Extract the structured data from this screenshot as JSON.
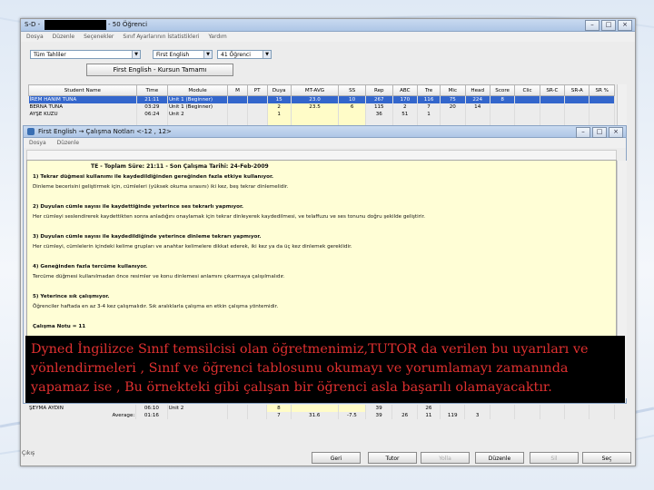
{
  "window": {
    "title_prefix": "S-D -",
    "title_suffix": "- 50 Öğrenci",
    "menu": [
      "Dosya",
      "Düzenle",
      "Seçenekler",
      "Sınıf Ayarlarının İstatistikleri",
      "Yardım"
    ]
  },
  "toolbar": {
    "filter_value": "Tüm Tahliler",
    "course_value": "First English",
    "students_value": "41 Öğrenci",
    "course_button": "First English  -  Kursun Tamamı"
  },
  "table": {
    "headers": [
      "Student Name",
      "Time",
      "Module",
      "M",
      "PT",
      "Duya",
      "MT-AVG",
      "SS",
      "Rep",
      "ABC",
      "Tre",
      "Mic",
      "Head",
      "Score",
      "Clic",
      "SR-C",
      "SR-A",
      "SR %"
    ],
    "rows": [
      [
        "İREM HANIM TUNA",
        "21:11",
        "Unit 1 (Beginner)",
        "",
        "",
        "15",
        "23.0",
        "10",
        "267",
        "170",
        "116",
        "75",
        "224",
        "8",
        "",
        "",
        "",
        ""
      ],
      [
        "BERNA TUNA",
        "03:29",
        "Unit 1 (Beginner)",
        "",
        "",
        "2",
        "23.5",
        "6",
        "115",
        "2",
        "7",
        "20",
        "14",
        "",
        "",
        "",
        "",
        ""
      ],
      [
        "AYŞE KUZU",
        "06:24",
        "Unit 2",
        "",
        "",
        "1",
        "",
        "",
        "36",
        "51",
        "1",
        "",
        "",
        "",
        "",
        "",
        "",
        ""
      ],
      [
        "",
        "",
        "",
        "",
        "",
        "",
        "",
        "",
        "",
        "",
        "",
        "",
        "",
        "",
        "",
        "",
        "",
        ""
      ]
    ],
    "bottom_rows": [
      [
        "ŞEYMA AYDIN",
        "06:10",
        "Unit 2",
        "",
        "",
        "8",
        "",
        "",
        "39",
        "",
        "26",
        "",
        "",
        "",
        "",
        "",
        "",
        ""
      ]
    ],
    "average": [
      "Average:",
      "01:16",
      "",
      "",
      "",
      "7",
      "31.6",
      "-7.5",
      "39",
      "26",
      "11",
      "119",
      "3",
      "",
      "",
      "",
      "",
      ""
    ]
  },
  "inner_window": {
    "title": "First English  →  Çalışma Notları <-12 , 12>",
    "menu": [
      "Dosya",
      "Düzenle"
    ],
    "header_line": "TE  -  Toplam Süre: 21:11  -  Son Çalışma Tarihi: 24-Feb-2009",
    "paragraphs": [
      "1) Tekrar düğmesi kullanımı ile kaydedildiğinden gereğinden fazla etkiye kullanıyor.",
      "Dinleme becerisini geliştirmek için, cümleleri (yüksek okuma sırasını) iki kez, beş tekrar dinlemelidir.",
      "",
      "2) Duyulan cümle sayısı ile kaydettiğinde yeterince ses tekrarlı yapmıyor.",
      "Her cümleyi seslendirerek kaydettikten sonra anladığını onaylamak için tekrar dinleyerek kaydedilmesi, ve telaffuzu ve ses tonunu doğru şekilde geliştirir.",
      "",
      "3) Duyulan cümle sayısı ile kaydedildiğinde yeterince dinleme tekrarı yapmıyor.",
      "Her cümleyi, cümlelerin içindeki kelime grupları ve anahtar kelimelere dikkat ederek, iki kez ya da üç kez dinlemek gereklidir.",
      "",
      "4) Geneğinden fazla tercüme kullanıyor.",
      "Tercüme düğmesi kullanılmadan önce resimler ve konu dinlemesi anlamını çıkarmaya çalışılmalıdır.",
      "",
      "5) Yeterince sık çalışmıyor.",
      "Öğrenciler haftada en az 3-4 kez çalışmalıdır. Sık aralıklarla çalışma en etkin çalışma yöntemidir.",
      "",
      "Çalışma Notu = 11"
    ]
  },
  "buttons": [
    "Geri",
    "Tutor",
    "Yolla",
    "Düzenle",
    "Sil",
    "Seç"
  ],
  "status_label": "Çıkış",
  "caption": {
    "lines": [
      "Dyned İngilizce Sınıf temsilcisi olan öğretmenimiz,TUTOR  da verilen bu uyarıları ve",
      "yönlendirmeleri , Sınıf ve öğrenci tablosunu okumayı ve yorumlamayı zamanında",
      "yapamaz ise , Bu örnekteki gibi çalışan bir öğrenci asla başarılı olamayacaktır."
    ]
  },
  "colors": {
    "caption_text": "#e03030",
    "selection": "#3366cc",
    "notes_background": "#fffed6"
  }
}
